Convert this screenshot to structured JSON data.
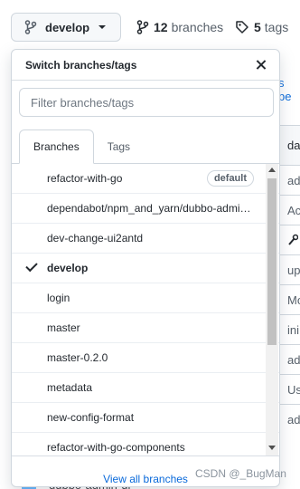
{
  "branch_button": {
    "label": "develop"
  },
  "repo_meta": {
    "branches_count": "12",
    "branches_label": "branches",
    "tags_count": "5",
    "tags_label": "tags"
  },
  "background": {
    "link_text": "s be",
    "header_cell": "dat",
    "rows": [
      "adj",
      "Ac",
      "",
      "up",
      "Mo",
      "ini",
      "adj",
      "Us",
      "adj"
    ],
    "bottom_item": "dubbo-admin-ui"
  },
  "dropdown": {
    "title": "Switch branches/tags",
    "filter_placeholder": "Filter branches/tags",
    "tabs": [
      {
        "label": "Branches",
        "active": true
      },
      {
        "label": "Tags",
        "active": false
      }
    ],
    "branches": [
      {
        "name": "refactor-with-go",
        "badge": "default",
        "selected": false
      },
      {
        "name": "dependabot/npm_and_yarn/dubbo-admin-ui/...",
        "selected": false
      },
      {
        "name": "dev-change-ui2antd",
        "selected": false
      },
      {
        "name": "develop",
        "selected": true
      },
      {
        "name": "login",
        "selected": false
      },
      {
        "name": "master",
        "selected": false
      },
      {
        "name": "master-0.2.0",
        "selected": false
      },
      {
        "name": "metadata",
        "selected": false
      },
      {
        "name": "new-config-format",
        "selected": false
      },
      {
        "name": "refactor-with-go-components",
        "selected": false
      }
    ],
    "footer_link": "View all branches"
  },
  "watermark": "CSDN @_BugMan",
  "colors": {
    "accent": "#0969da",
    "border": "#d0d7de",
    "text": "#24292f",
    "muted": "#57606a"
  }
}
